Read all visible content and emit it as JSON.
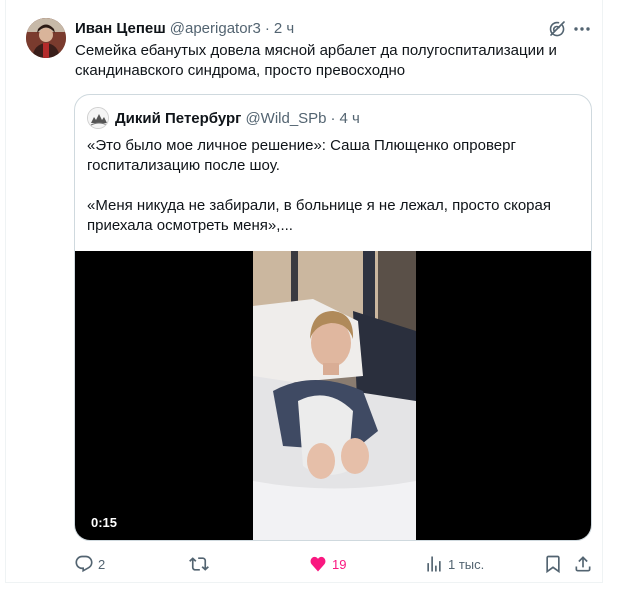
{
  "tweet": {
    "author_name": "Иван Цепеш",
    "author_handle": "@aperigator3",
    "dot": "·",
    "time": "2 ч",
    "text": "Семейка ебанутых довела мясной арбалет да полугоспитализации и скандинавского синдрома, просто превосходно"
  },
  "quote": {
    "author_name": "Дикий Петербург",
    "author_handle": "@Wild_SPb",
    "dot": "·",
    "time": "4 ч",
    "paragraph1": "«Это было мое личное решение»:  Саша Плющенко опроверг госпитализацию после шоу.",
    "paragraph2": "«Меня никуда не забирали, в больнице я не лежал, просто скорая приехала осмотреть меня»,...",
    "video_duration": "0:15"
  },
  "actions": {
    "replies": "2",
    "retweets": "",
    "likes": "19",
    "views": "1 тыс.",
    "liked": true
  },
  "icons": {
    "grok": "grok-icon",
    "more": "more-icon",
    "reply": "reply-icon",
    "retweet": "retweet-icon",
    "like": "heart-icon",
    "views": "views-icon",
    "bookmark": "bookmark-icon",
    "share": "share-icon"
  },
  "colors": {
    "text": "#0f1419",
    "secondary": "#536471",
    "like": "#f91880",
    "border": "#cfd9de"
  }
}
